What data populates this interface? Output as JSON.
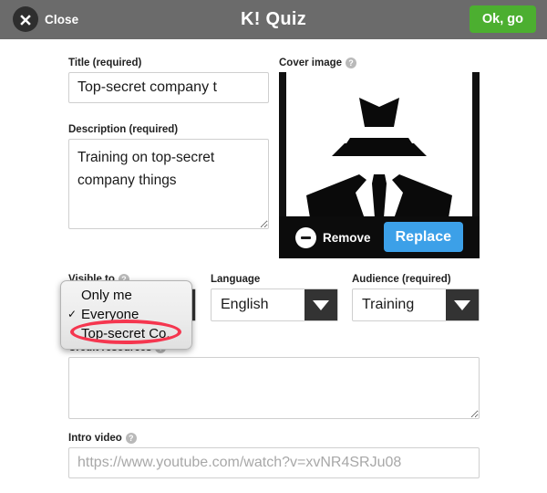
{
  "header": {
    "close_label": "Close",
    "title": "K! Quiz",
    "ok_label": "Ok, go",
    "background_color": "#6b6b6b",
    "ok_color": "#4caf30"
  },
  "form": {
    "title": {
      "label": "Title (required)",
      "value": "Top-secret company t"
    },
    "description": {
      "label": "Description (required)",
      "value": "Training on top-secret company things"
    },
    "cover_image": {
      "label": "Cover image",
      "help": "?",
      "remove_label": "Remove",
      "replace_label": "Replace",
      "replace_color": "#3ca0e8",
      "alt": "black silhouette of a person wearing a fedora hat, suit and tie"
    },
    "visible_to": {
      "label": "Visible to",
      "help": "?",
      "value": "Everyone",
      "options": [
        {
          "label": "Only me",
          "checked": false
        },
        {
          "label": "Everyone",
          "checked": true
        },
        {
          "label": "Top-secret Co.",
          "checked": false
        }
      ],
      "check_glyph": "✓",
      "highlighted_option": "Top-secret Co.",
      "highlight_color": "#f5364f",
      "open": true
    },
    "language": {
      "label": "Language",
      "value": "English"
    },
    "audience": {
      "label": "Audience (required)",
      "value": "Training"
    },
    "credit_resources": {
      "label": "Credit resources",
      "help": "?",
      "value": "",
      "placeholder": ""
    },
    "intro_video": {
      "label": "Intro video",
      "help": "?",
      "value": "",
      "placeholder": "https://www.youtube.com/watch?v=xvNR4SRJu08"
    }
  }
}
